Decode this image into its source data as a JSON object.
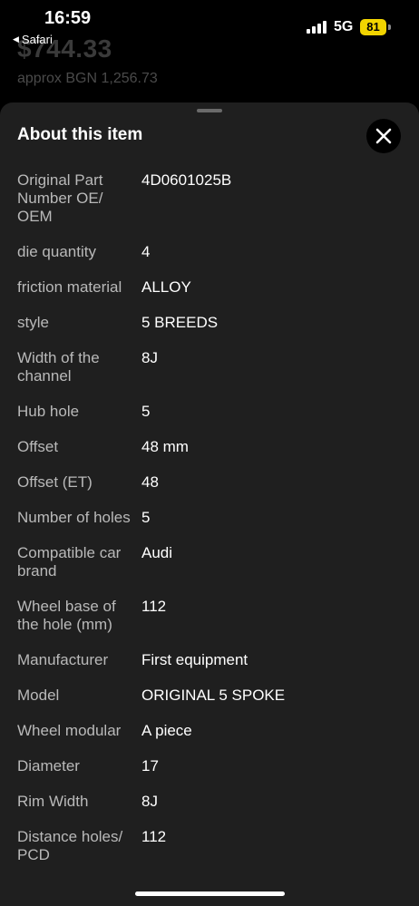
{
  "status_bar": {
    "time": "16:59",
    "back_app": "Safari",
    "network": "5G",
    "battery": "81"
  },
  "background_page": {
    "price": "$744.33",
    "approx": "approx BGN 1,256.73"
  },
  "sheet": {
    "title": "About this item",
    "close_icon": "close-icon",
    "specs": [
      {
        "label": "Original Part Number OE/ OEM",
        "value": "4D0601025B"
      },
      {
        "label": "die quantity",
        "value": "4"
      },
      {
        "label": "friction material",
        "value": "ALLOY"
      },
      {
        "label": "style",
        "value": "5 BREEDS"
      },
      {
        "label": "Width of the channel",
        "value": "8J"
      },
      {
        "label": "Hub hole",
        "value": "5"
      },
      {
        "label": "Offset",
        "value": "48 mm"
      },
      {
        "label": "Offset (ET)",
        "value": "48"
      },
      {
        "label": "Number of holes",
        "value": "5"
      },
      {
        "label": "Compatible car brand",
        "value": "Audi"
      },
      {
        "label": "Wheel base of the hole (mm)",
        "value": "112"
      },
      {
        "label": "Manufacturer",
        "value": "First equipment"
      },
      {
        "label": "Model",
        "value": "ORIGINAL 5 SPOKE"
      },
      {
        "label": "Wheel modular",
        "value": "A piece"
      },
      {
        "label": "Diameter",
        "value": "17"
      },
      {
        "label": "Rim Width",
        "value": "8J"
      },
      {
        "label": "Distance holes/ PCD",
        "value": "112"
      }
    ]
  },
  "colors": {
    "sheet_bg": "#1f1f1f",
    "label": "#b9b9b9",
    "value": "#ffffff",
    "battery": "#f2d400"
  }
}
